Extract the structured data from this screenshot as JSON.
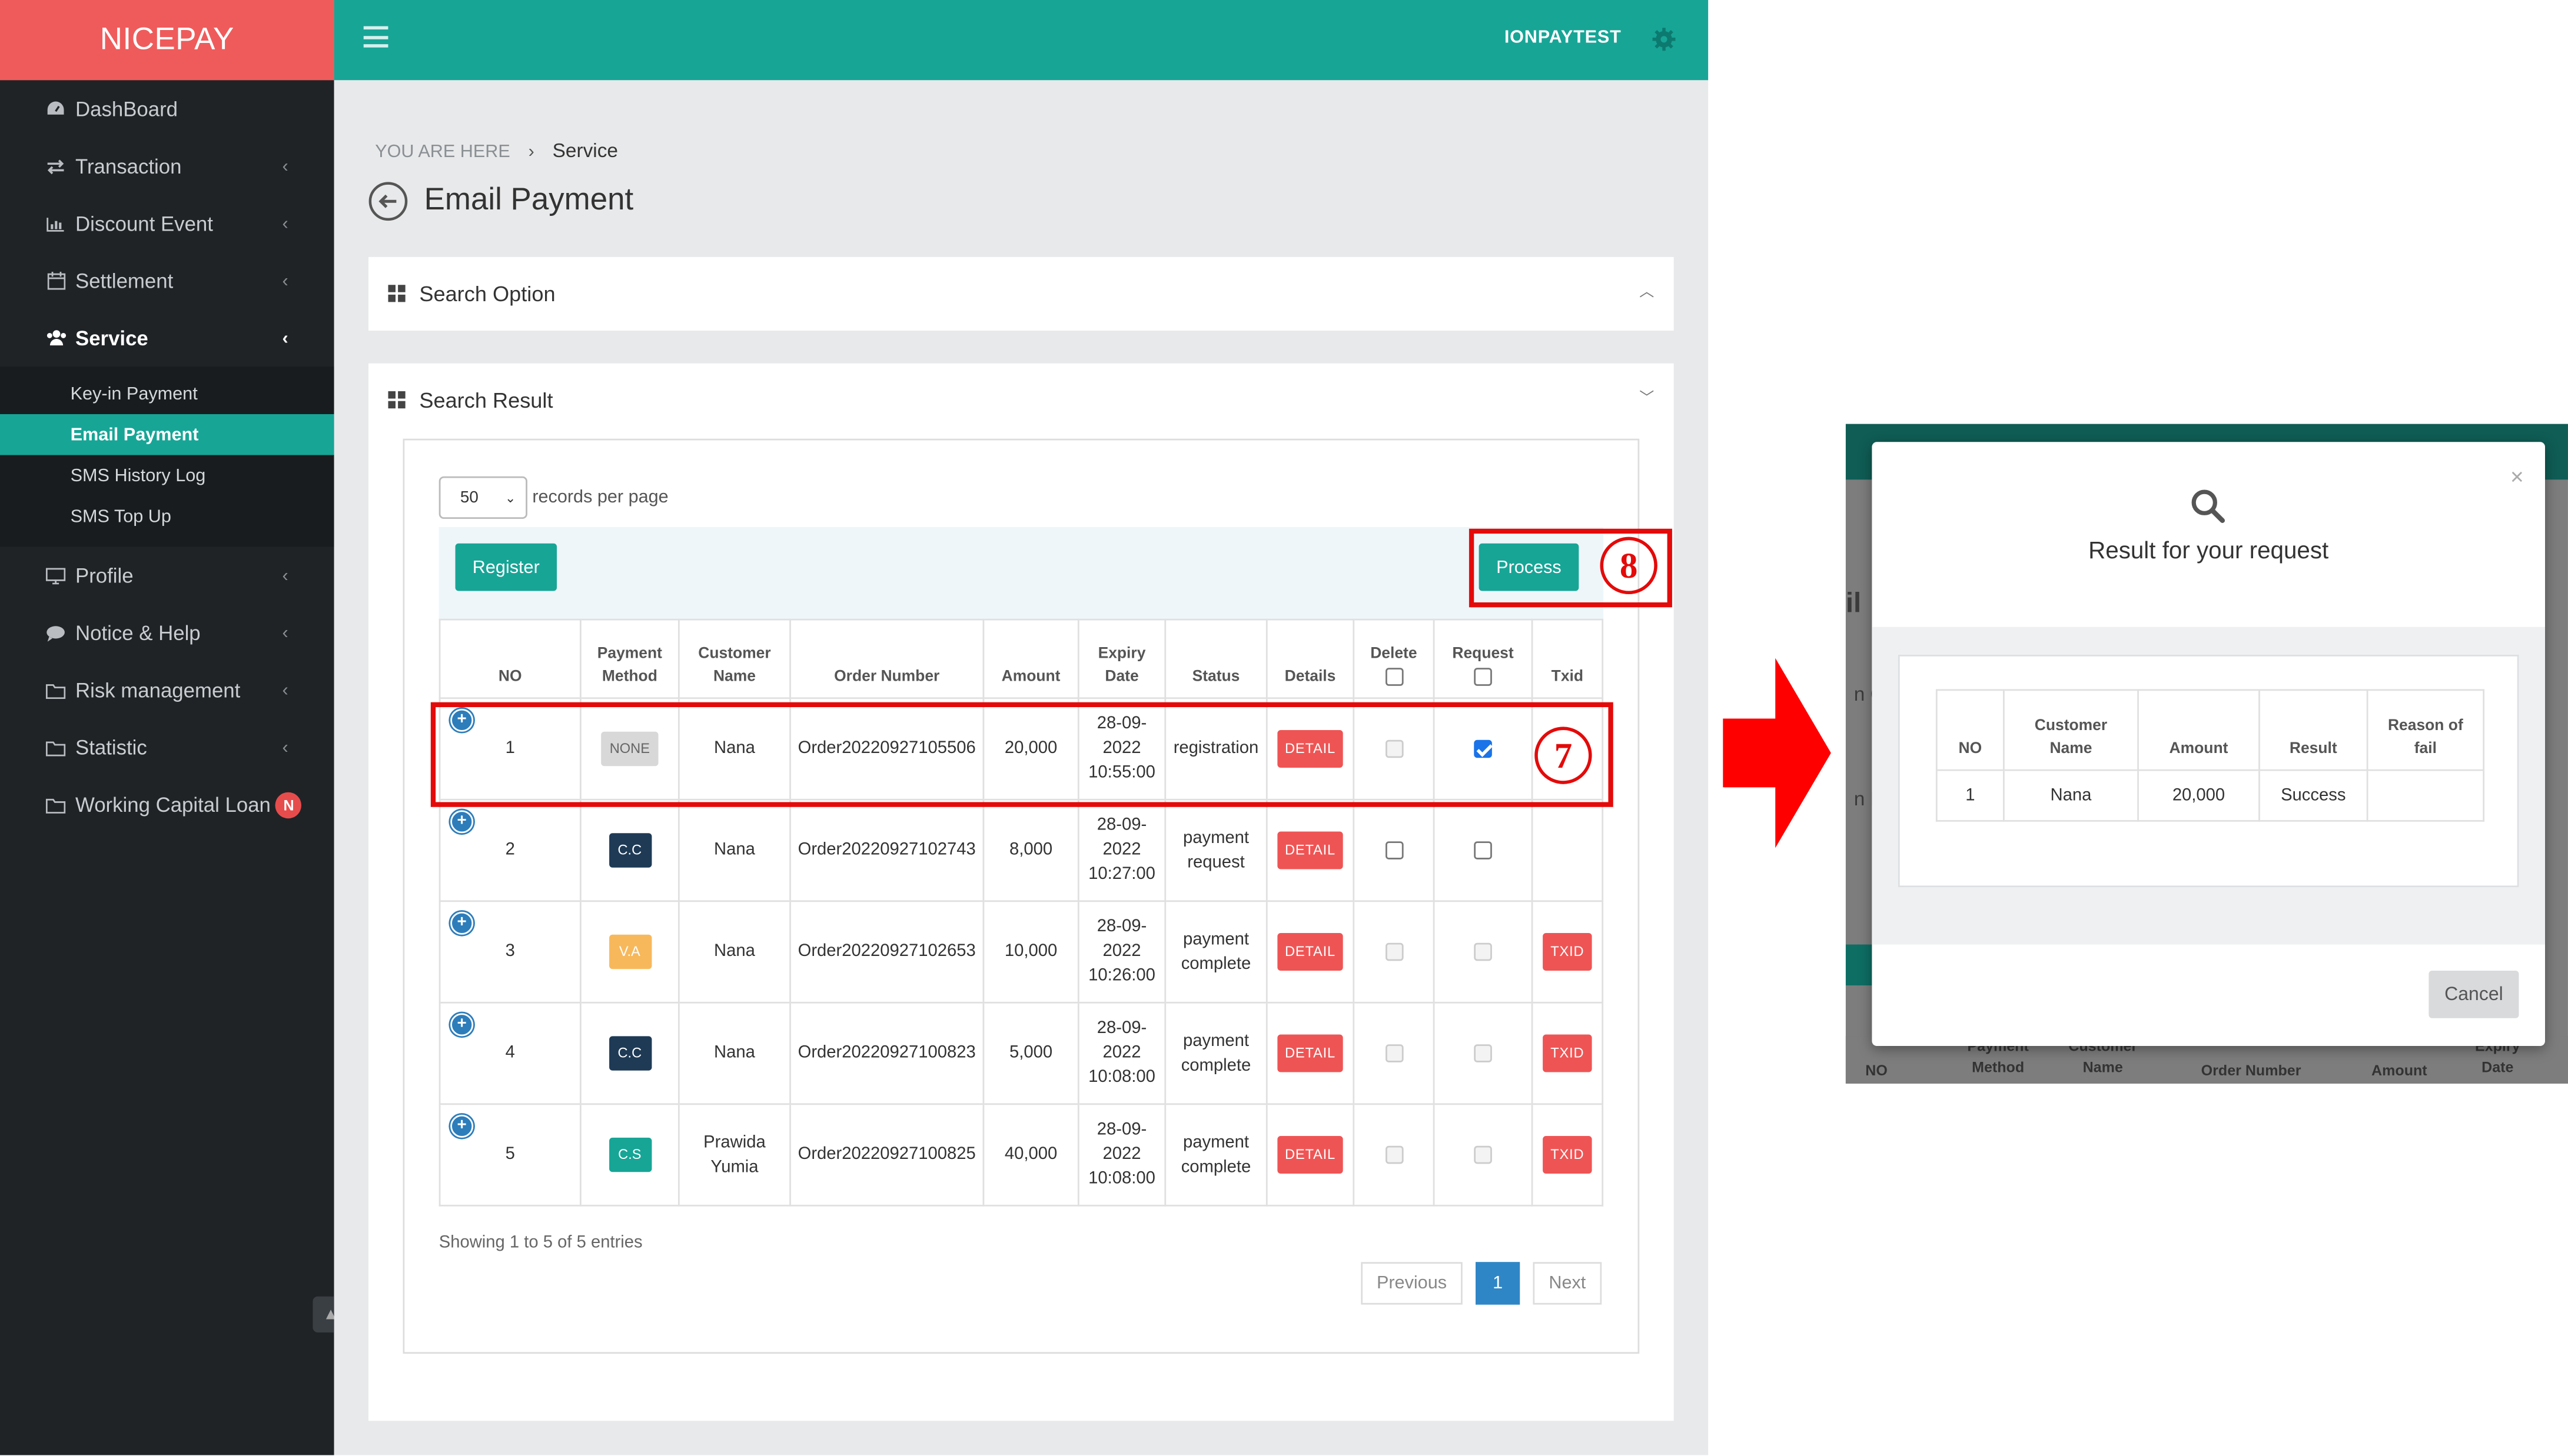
{
  "brand": "NICEPAY",
  "sidebar": {
    "items": [
      {
        "label": "DashBoard",
        "icon": "dashboard-icon"
      },
      {
        "label": "Transaction",
        "icon": "exchange-icon"
      },
      {
        "label": "Discount Event",
        "icon": "bar-chart-icon"
      },
      {
        "label": "Settlement",
        "icon": "calendar-icon"
      },
      {
        "label": "Service",
        "icon": "users-icon"
      },
      {
        "label": "Profile",
        "icon": "monitor-icon"
      },
      {
        "label": "Notice & Help",
        "icon": "comment-icon"
      },
      {
        "label": "Risk management",
        "icon": "folder-icon"
      },
      {
        "label": "Statistic",
        "icon": "folder-icon"
      },
      {
        "label": "Working Capital Loan",
        "icon": "folder-icon",
        "badge": "N"
      }
    ],
    "service_sub": [
      "Key-in Payment",
      "Email Payment",
      "SMS History Log",
      "SMS Top Up"
    ]
  },
  "topbar": {
    "user": "IONPAYTEST"
  },
  "breadcrumb": {
    "prefix": "YOU ARE HERE",
    "sep": "›",
    "current": "Service"
  },
  "page_title": "Email Payment",
  "search_option": {
    "title": "Search Option"
  },
  "search_result": {
    "title": "Search Result",
    "records_per_page": "50",
    "records_label": "records per page",
    "register_label": "Register",
    "process_label": "Process",
    "annotations": {
      "step7": "7",
      "step8": "8"
    },
    "columns": [
      "NO",
      "Payment Method",
      "Customer Name",
      "Order Number",
      "Amount",
      "Expiry Date",
      "Status",
      "Details",
      "Delete",
      "Request",
      "Txid"
    ],
    "rows": [
      {
        "no": "1",
        "method": "NONE",
        "customer": "Nana",
        "order": "Order20220927105506",
        "amount": "20,000",
        "date": "28-09-",
        "year": "2022",
        "time": "10:55:00",
        "status": "registration",
        "status2": "",
        "detail": "DETAIL",
        "txid": ""
      },
      {
        "no": "2",
        "method": "C.C",
        "customer": "Nana",
        "order": "Order20220927102743",
        "amount": "8,000",
        "date": "28-09-",
        "year": "2022",
        "time": "10:27:00",
        "status": "payment",
        "status2": "request",
        "detail": "DETAIL",
        "txid": ""
      },
      {
        "no": "3",
        "method": "V.A",
        "customer": "Nana",
        "order": "Order20220927102653",
        "amount": "10,000",
        "date": "28-09-",
        "year": "2022",
        "time": "10:26:00",
        "status": "payment",
        "status2": "complete",
        "detail": "DETAIL",
        "txid": "TXID"
      },
      {
        "no": "4",
        "method": "C.C",
        "customer": "Nana",
        "order": "Order20220927100823",
        "amount": "5,000",
        "date": "28-09-",
        "year": "2022",
        "time": "10:08:00",
        "status": "payment",
        "status2": "complete",
        "detail": "DETAIL",
        "txid": "TXID"
      },
      {
        "no": "5",
        "method": "C.S",
        "customer": "Prawida",
        "customer2": "Yumia",
        "order": "Order20220927100825",
        "amount": "40,000",
        "date": "28-09-",
        "year": "2022",
        "time": "10:08:00",
        "status": "payment",
        "status2": "complete",
        "detail": "DETAIL",
        "txid": "TXID"
      }
    ],
    "showing": "Showing 1 to 5 of 5 entries",
    "pagination": {
      "prev": "Previous",
      "page": "1",
      "next": "Next"
    }
  },
  "modal": {
    "title": "Result for your request",
    "close": "×",
    "columns": [
      "NO",
      "Customer Name",
      "Amount",
      "Result",
      "Reason of fail"
    ],
    "row": {
      "no": "1",
      "customer": "Nana",
      "amount": "20,000",
      "result": "Success",
      "reason": ""
    },
    "cancel": "Cancel",
    "background_headers": [
      "NO",
      "Payment Method",
      "Customer Name",
      "Order Number",
      "Amount",
      "Expiry Date"
    ]
  },
  "colors": {
    "brand": "#ef5b5b",
    "teal": "#17a596",
    "sidebar": "#1f2326",
    "highlight": "#e40a0a",
    "detail": "#ef5454"
  }
}
